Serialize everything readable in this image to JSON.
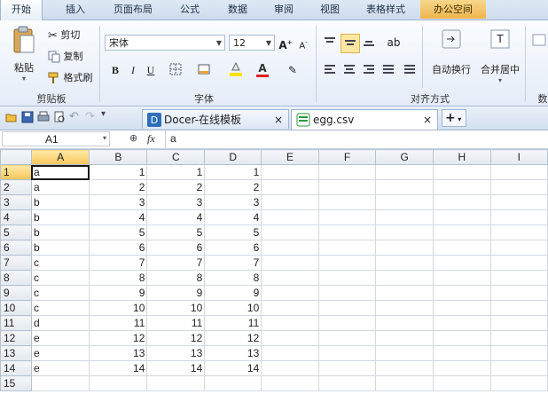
{
  "menu_tabs": [
    "开始",
    "插入",
    "页面布局",
    "公式",
    "数据",
    "审阅",
    "视图",
    "表格样式",
    "办公空间"
  ],
  "ribbon": {
    "clipboard": {
      "paste": "粘贴",
      "cut": "剪切",
      "copy": "复制",
      "format_painter": "格式刷",
      "label": "剪贴板"
    },
    "font": {
      "name": "宋体",
      "size": "12",
      "bold": "B",
      "italic": "I",
      "underline": "U",
      "label": "字体"
    },
    "alignment": {
      "wrap": "自动换行",
      "merge": "合并居中",
      "label": "对齐方式"
    },
    "number_partial": "数"
  },
  "doc_tabs": [
    {
      "label": "Docer-在线模板",
      "close": "×"
    },
    {
      "label": "egg.csv",
      "close": "×"
    }
  ],
  "new_tab": "+",
  "formula_bar": {
    "cell_ref": "A1",
    "fx": "fx",
    "value": "a"
  },
  "sheet": {
    "columns": [
      "A",
      "B",
      "C",
      "D",
      "E",
      "F",
      "G",
      "H",
      "I"
    ],
    "rows": [
      {
        "n": "1",
        "a": "a",
        "b": "1",
        "c": "1",
        "d": "1"
      },
      {
        "n": "2",
        "a": "a",
        "b": "2",
        "c": "2",
        "d": "2"
      },
      {
        "n": "3",
        "a": "b",
        "b": "3",
        "c": "3",
        "d": "3"
      },
      {
        "n": "4",
        "a": "b",
        "b": "4",
        "c": "4",
        "d": "4"
      },
      {
        "n": "5",
        "a": "b",
        "b": "5",
        "c": "5",
        "d": "5"
      },
      {
        "n": "6",
        "a": "b",
        "b": "6",
        "c": "6",
        "d": "6"
      },
      {
        "n": "7",
        "a": "c",
        "b": "7",
        "c": "7",
        "d": "7"
      },
      {
        "n": "8",
        "a": "c",
        "b": "8",
        "c": "8",
        "d": "8"
      },
      {
        "n": "9",
        "a": "c",
        "b": "9",
        "c": "9",
        "d": "9"
      },
      {
        "n": "10",
        "a": "c",
        "b": "10",
        "c": "10",
        "d": "10"
      },
      {
        "n": "11",
        "a": "d",
        "b": "11",
        "c": "11",
        "d": "11"
      },
      {
        "n": "12",
        "a": "e",
        "b": "12",
        "c": "12",
        "d": "12"
      },
      {
        "n": "13",
        "a": "e",
        "b": "13",
        "c": "13",
        "d": "13"
      },
      {
        "n": "14",
        "a": "e",
        "b": "14",
        "c": "14",
        "d": "14"
      },
      {
        "n": "15",
        "a": "",
        "b": "",
        "c": "",
        "d": ""
      }
    ]
  },
  "colors": {
    "accent": "#f6c75a",
    "tab_special": "#eeb54b",
    "font_color_bar": "#e02020",
    "highlight_bar": "#ffe000"
  }
}
